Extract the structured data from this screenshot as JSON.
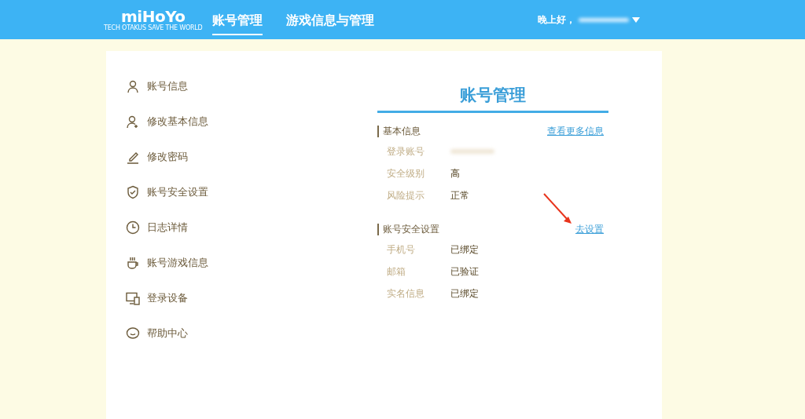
{
  "header": {
    "logo": "miHoYo",
    "tagline": "TECH OTAKUS SAVE THE WORLD",
    "nav": [
      {
        "label": "账号管理",
        "selected": true
      },
      {
        "label": "游戏信息与管理",
        "selected": false
      }
    ],
    "greeting": "晚上好，"
  },
  "sidebar": {
    "items": [
      {
        "label": "账号信息"
      },
      {
        "label": "修改基本信息"
      },
      {
        "label": "修改密码"
      },
      {
        "label": "账号安全设置"
      },
      {
        "label": "日志详情"
      },
      {
        "label": "账号游戏信息"
      },
      {
        "label": "登录设备"
      },
      {
        "label": "帮助中心"
      }
    ]
  },
  "main": {
    "title": "账号管理",
    "sections": [
      {
        "title": "基本信息",
        "link": "查看更多信息",
        "rows": [
          {
            "kind": "masked",
            "label": "登录账号"
          },
          {
            "kind": "text",
            "label": "安全级别",
            "value": "高"
          },
          {
            "kind": "text",
            "label": "风险提示",
            "value": "正常"
          }
        ]
      },
      {
        "title": "账号安全设置",
        "link": "去设置",
        "rows": [
          {
            "kind": "text",
            "label": "手机号",
            "value": "已绑定"
          },
          {
            "kind": "text",
            "label": "邮箱",
            "value": "已验证"
          },
          {
            "kind": "text",
            "label": "实名信息",
            "value": "已绑定"
          }
        ]
      }
    ]
  }
}
